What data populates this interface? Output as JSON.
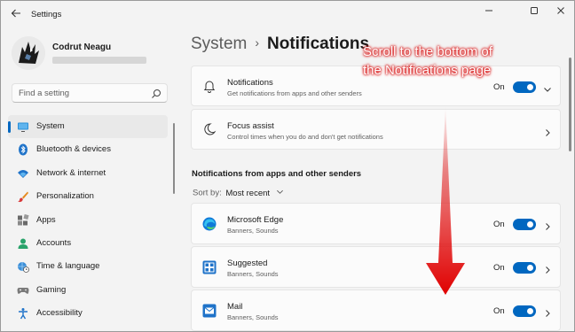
{
  "window": {
    "title": "Settings",
    "back_icon": "back-arrow-icon",
    "controls": [
      "minimize-icon",
      "maximize-icon",
      "close-icon"
    ]
  },
  "profile": {
    "name": "Codrut Neagu"
  },
  "search": {
    "placeholder": "Find a setting",
    "icon": "search-icon"
  },
  "sidebar": {
    "items": [
      {
        "label": "System",
        "icon": "monitor-icon",
        "active": true
      },
      {
        "label": "Bluetooth & devices",
        "icon": "bluetooth-icon",
        "active": false
      },
      {
        "label": "Network & internet",
        "icon": "wifi-icon",
        "active": false
      },
      {
        "label": "Personalization",
        "icon": "brush-icon",
        "active": false
      },
      {
        "label": "Apps",
        "icon": "apps-icon",
        "active": false
      },
      {
        "label": "Accounts",
        "icon": "person-icon",
        "active": false
      },
      {
        "label": "Time & language",
        "icon": "globe-clock-icon",
        "active": false
      },
      {
        "label": "Gaming",
        "icon": "gamepad-icon",
        "active": false
      },
      {
        "label": "Accessibility",
        "icon": "accessibility-icon",
        "active": false
      }
    ]
  },
  "breadcrumb": {
    "parent": "System",
    "separator": "›",
    "current": "Notifications"
  },
  "settings": {
    "notifications": {
      "title": "Notifications",
      "subtitle": "Get notifications from apps and other senders",
      "state": "On",
      "icon": "bell-icon"
    },
    "focus_assist": {
      "title": "Focus assist",
      "subtitle": "Control times when you do and don't get notifications",
      "icon": "moon-icon"
    }
  },
  "section": {
    "title": "Notifications from apps and other senders",
    "sort_label": "Sort by:",
    "sort_value": "Most recent"
  },
  "apps": [
    {
      "name": "Microsoft Edge",
      "subtitle": "Banners, Sounds",
      "state": "On",
      "icon": "edge-icon"
    },
    {
      "name": "Suggested",
      "subtitle": "Banners, Sounds",
      "state": "On",
      "icon": "suggested-icon"
    },
    {
      "name": "Mail",
      "subtitle": "Banners, Sounds",
      "state": "On",
      "icon": "mail-icon"
    }
  ],
  "annotation": {
    "line1": "Scroll to the bottom of",
    "line2": "the Notifications page",
    "color": "#e02020"
  },
  "colors": {
    "accent": "#0067c0",
    "background": "#f3f3f3",
    "card": "#fbfbfb"
  }
}
